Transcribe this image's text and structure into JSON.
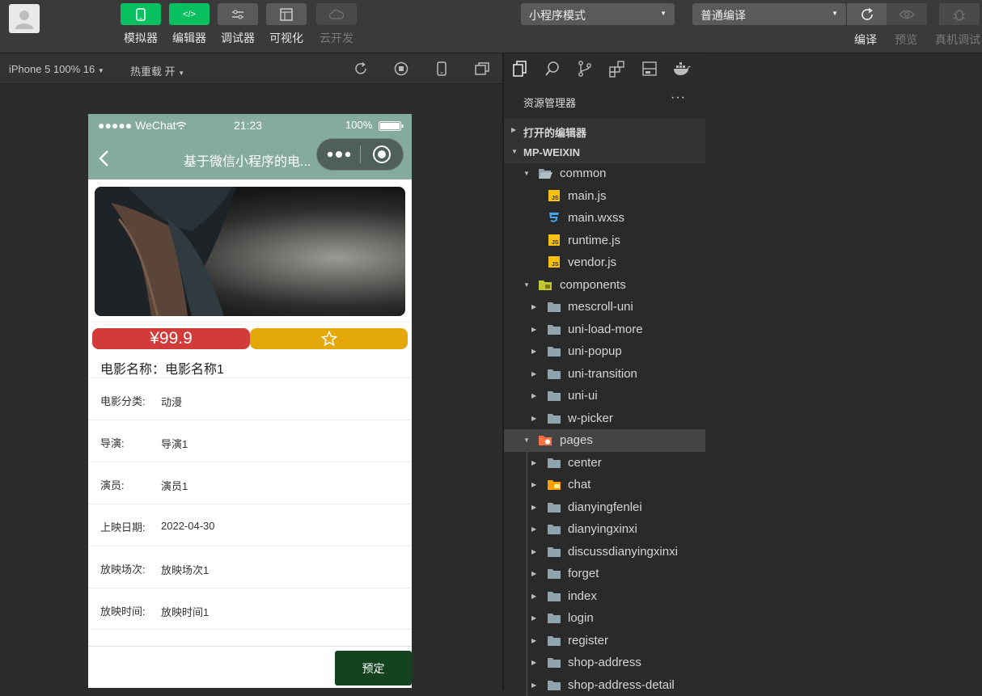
{
  "toolbar": {
    "buttons": [
      {
        "label": "模拟器"
      },
      {
        "label": "编辑器"
      },
      {
        "label": "调试器"
      },
      {
        "label": "可视化"
      },
      {
        "label": "云开发"
      }
    ],
    "mode_select": "小程序模式",
    "compile_select": "普通编译",
    "compile_label": "编译",
    "preview_label": "预览",
    "remote_debug_label": "真机调试"
  },
  "simbar": {
    "device": "iPhone 5 100% 16",
    "hot_reload": "热重载 开"
  },
  "phone": {
    "status": {
      "carrier": "●●●●● WeChat",
      "time": "21:23",
      "battery": "100%"
    },
    "nav_title": "基于微信小程序的电...",
    "price": "¥99.9",
    "movie_name": "电影名称：电影名称1",
    "details": [
      {
        "key": "电影分类:",
        "value": "动漫"
      },
      {
        "key": "导演:",
        "value": "导演1"
      },
      {
        "key": "演员:",
        "value": "演员1"
      },
      {
        "key": "上映日期:",
        "value": "2022-04-30"
      },
      {
        "key": "放映场次:",
        "value": "放映场次1"
      },
      {
        "key": "放映时间:",
        "value": "放映时间1"
      }
    ],
    "book_button": "预定"
  },
  "explorer": {
    "title": "资源管理器",
    "more": "···",
    "open_editors": "打开的编辑器",
    "project": "MP-WEIXIN",
    "items": [
      {
        "label": "common"
      },
      {
        "label": "main.js"
      },
      {
        "label": "main.wxss"
      },
      {
        "label": "runtime.js"
      },
      {
        "label": "vendor.js"
      },
      {
        "label": "components"
      },
      {
        "label": "mescroll-uni"
      },
      {
        "label": "uni-load-more"
      },
      {
        "label": "uni-popup"
      },
      {
        "label": "uni-transition"
      },
      {
        "label": "uni-ui"
      },
      {
        "label": "w-picker"
      },
      {
        "label": "pages"
      },
      {
        "label": "center"
      },
      {
        "label": "chat"
      },
      {
        "label": "dianyingfenlei"
      },
      {
        "label": "dianyingxinxi"
      },
      {
        "label": "discussdianyingxinxi"
      },
      {
        "label": "forget"
      },
      {
        "label": "index"
      },
      {
        "label": "login"
      },
      {
        "label": "register"
      },
      {
        "label": "shop-address"
      },
      {
        "label": "shop-address-detail"
      }
    ]
  },
  "colors": {
    "accent_green": "#07c160",
    "nav_bg": "#84ab9e",
    "price_red": "#d13b3a",
    "fav_yellow": "#e5a80a",
    "book_green": "#13441f"
  }
}
